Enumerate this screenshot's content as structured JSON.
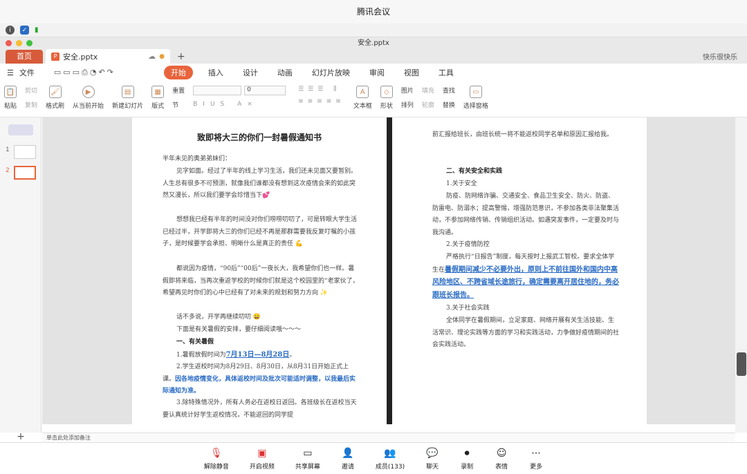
{
  "meeting": {
    "title": "腾讯会议"
  },
  "window": {
    "title": "安全.pptx"
  },
  "tabs": {
    "home": "首页",
    "file": "安全.pptx",
    "user": "快乐很快乐"
  },
  "menu": {
    "file": "文件",
    "items": [
      "开始",
      "插入",
      "设计",
      "动画",
      "幻灯片放映",
      "审阅",
      "视图",
      "工具"
    ]
  },
  "ribbon": {
    "paste": "粘贴",
    "cut": "剪切",
    "copy": "复制",
    "format_painter": "格式刷",
    "from_current": "从当前开始",
    "new_slide": "新建幻灯片",
    "layout": "版式",
    "reset": "重置",
    "section": "节",
    "font_size": "0",
    "textbox": "文本框",
    "shape": "形状",
    "picture": "图片",
    "fill": "填充",
    "arrange": "排列",
    "outline": "轮廓",
    "find": "查找",
    "replace": "替换",
    "select_pane": "选择窗格"
  },
  "slides": [
    "1",
    "2"
  ],
  "doc": {
    "title": "致即将大三的你们一封暑假通知书",
    "greeting": "半年未见的奥弟弟妹们：",
    "p1": "见字如面。经过了半年的线上学习生活，我们还未见面又要暂别。人生总有很多不可预测，就像我们谁都没有想到这次疫情会来的如此突然又漫长，所以我们要学会珍惜当下💕",
    "p2": "想想我已经有半年的时间没对你们唠唠叨叨了，可是转眼大学生活已经过半，开学即将大三的你们已经不再是那群需要我反复叮嘱的小孩子，是时候要学会承担、明晰什么是真正的责任 💪",
    "p3": "都说因为疫情，“90后”“00后”一夜长大，我希望你们也一样。暑假即将来临，当再次重返学校的时候你们就是这个校园里的“老家伙了，希望再见时你们的心中已经有了对未来的规划和努力方向 ✨",
    "p4": "话不多说，开学再继续叨叨 😄",
    "p5": "下面是有关暑假的安排，要仔细阅读哦～～～",
    "h1": "一、有关暑假",
    "item1_pre": "1.暑假放假时间为",
    "item1_date": "7月13日—8月28日",
    "item1_post": "。",
    "item2_pre": "2.学生返校时间为8月29日、8月30日，从8月31日开始正式上课。",
    "item2_blue": "因各地疫情变化，具体返校时间及批次可能适时调整，以我最后实际通知为准。",
    "item3": "3.除特殊情况外，所有人务必在返校日返回。各班级长在返校当天要认真统计好学生返校情况，不能返回的同学提",
    "r_top": "前汇报给班长，由班长统一将不能返校同学名单和原因汇报给我。",
    "h2": "二、有关安全和实践",
    "s1": "1.关于安全",
    "s1_text": "防疫、防网络诈骗、交通安全、食品卫生安全、防火、防盗、防雷电、防溺水；提高警惕，增强防范意识，不参加各类非法聚集活动，不参加网络传销、传销组织活动。如遇突发事件，一定要及时与我沟通。",
    "s2": "2.关于疫情防控",
    "s2_pre": "严格执行“日报告”制度，每天按时上报武工智校。要求全体学生在",
    "s2_blue": "暑假期间减少不必要外出，原则上不前往国外和国内中高风险地区、不跨省域长途旅行，确定需要离开居住地的，务必跟班长报告。",
    "s3": "3.关于社会实践",
    "s3_text": "全体同学在暑假期间，立足家庭、网络开展有关生活技能、生活常识、理论实践等方面的学习和实践活动，力争做好疫情期间的社会实践活动。"
  },
  "notes": "单击此处添加备注",
  "bottom": [
    "解除静音",
    "开启视频",
    "共享屏幕",
    "邀请",
    "成员(133)",
    "聊天",
    "录制",
    "表情",
    "更多"
  ]
}
